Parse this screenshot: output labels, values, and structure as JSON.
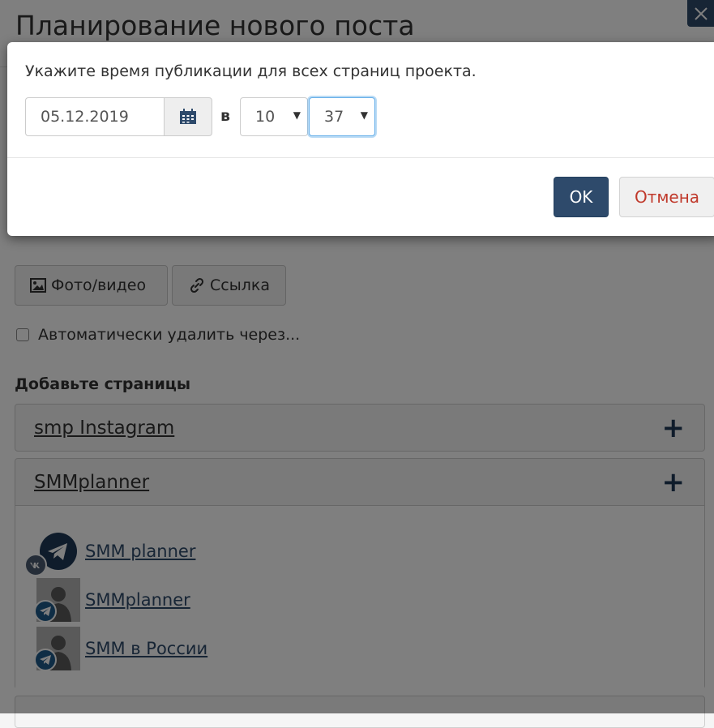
{
  "page": {
    "title": "Планирование нового поста",
    "media_button_label": "Фото/видео",
    "link_button_label": "Ссылка",
    "autodelete_label": "Автоматически удалить через...",
    "pages_section_title": "Добавьте страницы",
    "panels": [
      {
        "name": "smp Instagram"
      },
      {
        "name": "SMMplanner",
        "accounts": [
          {
            "name": "SMM planner",
            "network": "vk-icon"
          },
          {
            "name": "SMMplanner",
            "network": "telegram-icon"
          },
          {
            "name": "SMM в России",
            "network": "telegram-icon"
          }
        ]
      }
    ]
  },
  "modal": {
    "prompt": "Укажите время публикации для всех страниц проекта.",
    "date_value": "05.12.2019",
    "at_label": "в",
    "hour_value": "10",
    "minute_value": "37",
    "ok_label": "OK",
    "cancel_label": "Отмена"
  },
  "colors": {
    "primary": "#2e4a6b",
    "cancel_text": "#c0392b",
    "focus": "#66afe9"
  }
}
